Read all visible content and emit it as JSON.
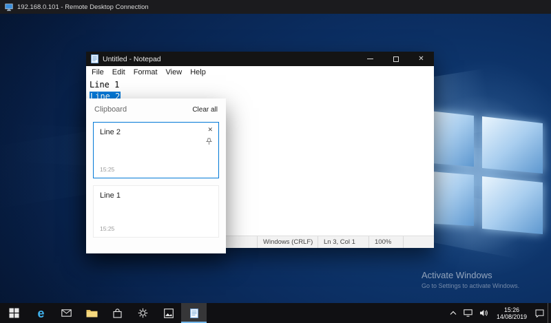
{
  "rdp": {
    "title": "192.168.0.101 - Remote Desktop Connection"
  },
  "notepad": {
    "title": "Untitled - Notepad",
    "menu": [
      "File",
      "Edit",
      "Format",
      "View",
      "Help"
    ],
    "text_lines": [
      "Line 1",
      "Line 2"
    ],
    "selected_line_index": 1,
    "status": {
      "line_ending": "Windows (CRLF)",
      "cursor": "Ln 3, Col 1",
      "zoom": "100%"
    }
  },
  "clipboard_panel": {
    "title": "Clipboard",
    "clear_all": "Clear all",
    "items": [
      {
        "text": "Line 2",
        "time": "15:25",
        "selected": true
      },
      {
        "text": "Line 1",
        "time": "15:25",
        "selected": false
      }
    ]
  },
  "watermark": {
    "title": "Activate Windows",
    "subtitle": "Go to Settings to activate Windows."
  },
  "taskbar": {
    "apps": [
      "start",
      "edge",
      "mail",
      "file-explorer",
      "store",
      "settings",
      "photos",
      "notepad"
    ],
    "active_app": "notepad",
    "tray": {
      "time": "15:26",
      "date": "14/08/2019"
    }
  },
  "glyphs": {
    "close": "✕",
    "card_close": "✕",
    "edge": "e"
  },
  "colors": {
    "accent": "#0078d7",
    "selection": "#0078d7",
    "taskbar_active_underline": "#76b9ed"
  }
}
